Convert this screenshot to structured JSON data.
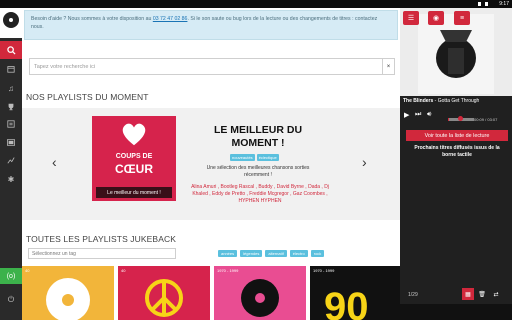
{
  "statusbar": {
    "time": "9:17"
  },
  "sidebar": {
    "items": [
      "search-icon",
      "calendar-icon",
      "music-note-icon",
      "trophy-icon",
      "list-icon",
      "video-icon",
      "stats-icon",
      "gear-icon"
    ],
    "green_label": "(o)",
    "power_icon": "power-icon"
  },
  "notice": {
    "before": "Besoin d'aide ? Nous sommes à votre disposition au ",
    "phone": "03 72 47 02 86",
    "after": ". Si le son saute ou bug lors de la lecture ou des changements de titres : contactez nous."
  },
  "search": {
    "placeholder": "Tapez votre recherche ici",
    "clear": "×"
  },
  "sections": {
    "moment": "NOS PLAYLISTS DU MOMENT",
    "all": "TOUTES LES PLAYLISTS JUKEBACK"
  },
  "featured": {
    "cover_line1": "COUPS DE",
    "cover_line2": "CŒUR",
    "cover_band": "Le meilleur du moment !",
    "title": "LE MEILLEUR DU MOMENT !",
    "tags": [
      "nouveautés",
      "éclectique"
    ],
    "description": "Une sélection des meilleures chansons sorties récemment !",
    "artists": "Alina Amuri , Bootleg Rascal , Buddy , David Byrne , Dada , Dj Khaled , Eddy de Pretto , Freddie Mcgregor , Gaz Coombes , HYPHEN HYPHEN",
    "prev": "‹",
    "next": "›"
  },
  "filter": {
    "placeholder": "Sélectionnez un tag",
    "tags": [
      "années",
      "légendes",
      "alternatif",
      "électro",
      "rock"
    ]
  },
  "thumbs": [
    {
      "meta": "40",
      "color": "#f2b53a"
    },
    {
      "meta": "40",
      "color": "#d6234c"
    },
    {
      "meta": "1970 - 1999",
      "color": "#e94d92"
    },
    {
      "meta": "1970 - 1999",
      "color": "#111111"
    }
  ],
  "player": {
    "artist": "The Blinders",
    "song": " - Gotta Get Through",
    "time": "00:09 / 03:07",
    "progress": 0.05,
    "queue_button": "Voir toute la liste de lecture",
    "next_title": "Prochains titres diffusés issus de la borne tactile",
    "count": "1/29"
  },
  "colors": {
    "accent": "#d1283c",
    "info": "#5bc0de",
    "green": "#3cb24b"
  }
}
